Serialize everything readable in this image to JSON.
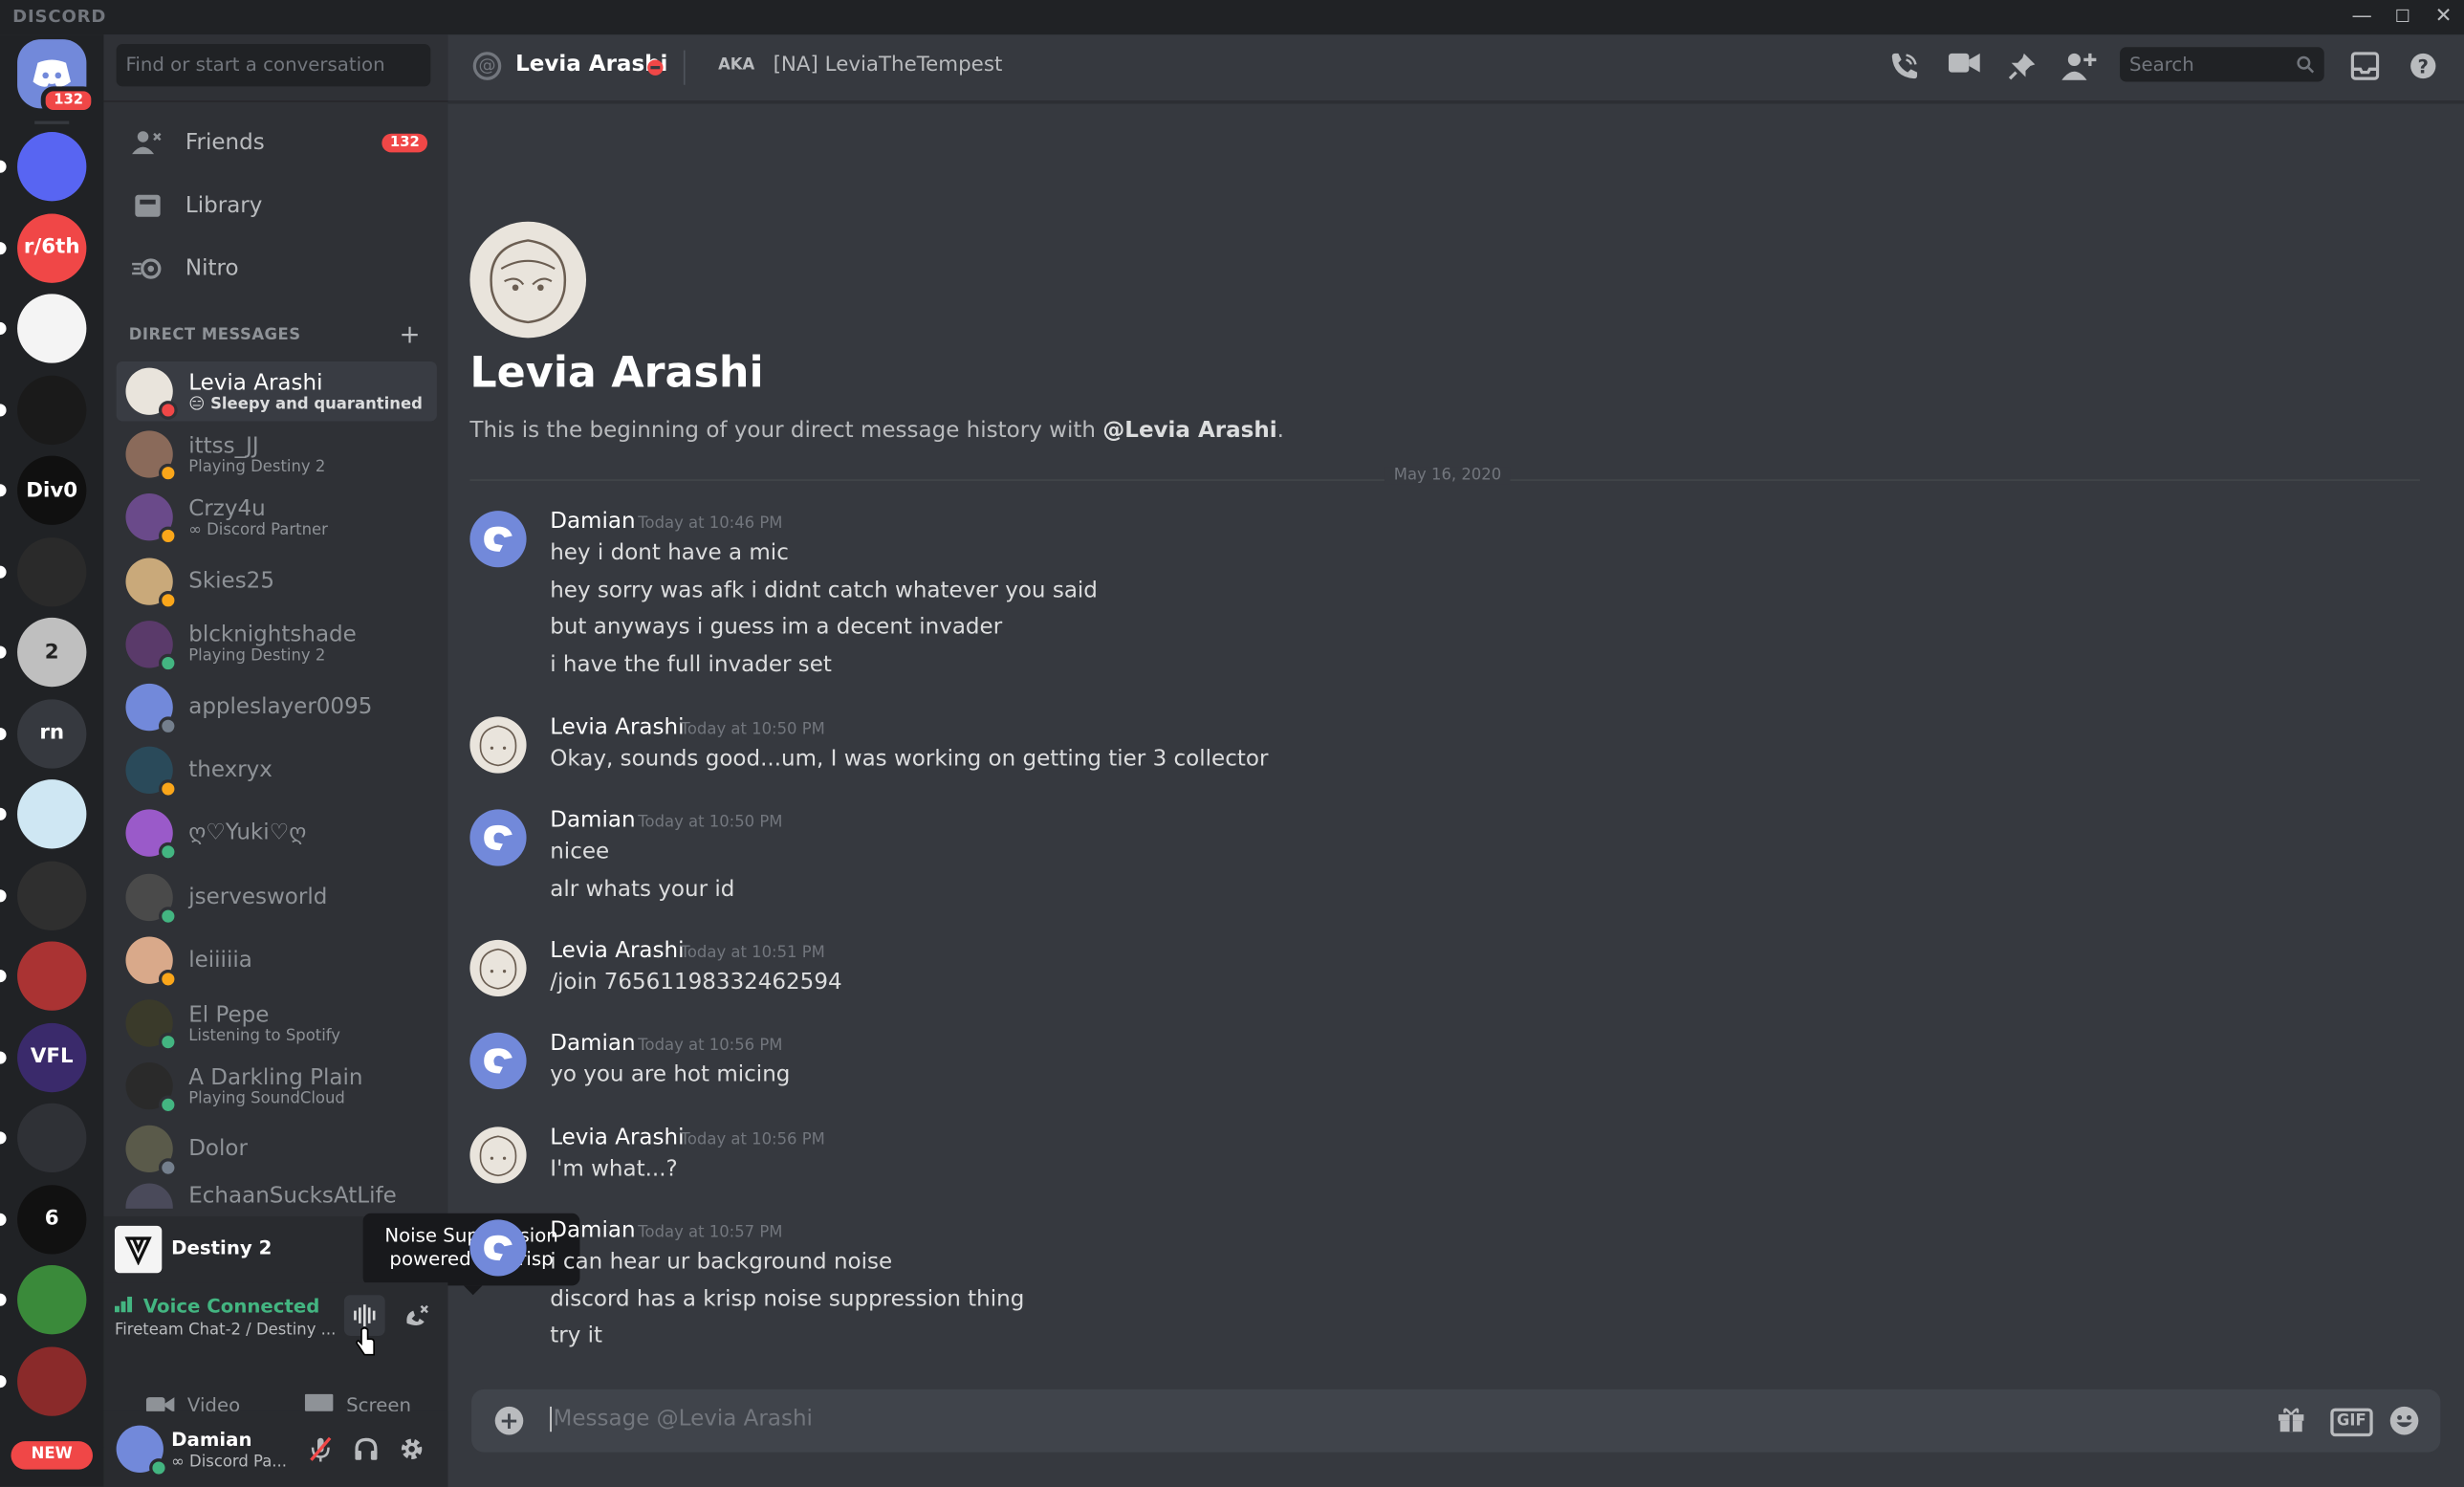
{
  "app": {
    "title": "DISCORD"
  },
  "window": {
    "minimize": "—",
    "maximize": "☐",
    "close": "✕"
  },
  "guilds": {
    "home_badge": "132",
    "items": [
      {
        "label": "",
        "color": "#5865f2"
      },
      {
        "label": "r/6th",
        "color": "#f04747"
      },
      {
        "label": "",
        "color": "#f4f4f4"
      },
      {
        "label": "",
        "color": "#1a1a1a"
      },
      {
        "label": "Div0",
        "color": "#101010"
      },
      {
        "label": "",
        "color": "#2a2a2a"
      },
      {
        "label": "2",
        "color": "#bfbfbf"
      },
      {
        "label": "rn",
        "color": "#36393f"
      },
      {
        "label": "",
        "color": "#cfe7f3"
      },
      {
        "label": "",
        "color": "#2f2f2f"
      },
      {
        "label": "",
        "color": "#a33"
      },
      {
        "label": "VFL",
        "color": "#3a2a6b"
      },
      {
        "label": "",
        "color": "#2f3136"
      },
      {
        "label": "6",
        "color": "#111111"
      },
      {
        "label": "",
        "color": "#3a8a3a"
      },
      {
        "label": "",
        "color": "#8a2a2a"
      }
    ],
    "new_label": "NEW"
  },
  "sidebar": {
    "search_placeholder": "Find or start a conversation",
    "nav": [
      {
        "label": "Friends",
        "badge": "132"
      },
      {
        "label": "Library"
      },
      {
        "label": "Nitro"
      }
    ],
    "dm_header": "DIRECT MESSAGES",
    "dms": [
      {
        "name": "Levia Arashi",
        "sub": "😑 Sleepy and quarantined",
        "status": "#f04747",
        "avatar": "#e9e4dc",
        "selected": true
      },
      {
        "name": "ittss_JJ",
        "sub": "Playing Destiny 2",
        "status": "#faa61a",
        "avatar": "#8a6a5a"
      },
      {
        "name": "Crzy4u",
        "sub": "∞ Discord Partner",
        "status": "#faa61a",
        "avatar": "#6a4a8a"
      },
      {
        "name": "Skies25",
        "sub": "",
        "status": "#faa61a",
        "avatar": "#c9a97a"
      },
      {
        "name": "blcknightshade",
        "sub": "Playing Destiny 2",
        "status": "#43b581",
        "avatar": "#5a3a6a"
      },
      {
        "name": "appleslayer0095",
        "sub": "",
        "status": "#747f8d",
        "avatar": "#7289da"
      },
      {
        "name": "thexryx",
        "sub": "",
        "status": "#faa61a",
        "avatar": "#2a4a5a"
      },
      {
        "name": "ღ♡Yuki♡ღ",
        "sub": "",
        "status": "#43b581",
        "avatar": "#9a5ac9"
      },
      {
        "name": "jservesworld",
        "sub": "",
        "status": "#43b581",
        "avatar": "#4a4a4a"
      },
      {
        "name": "leiiiiia",
        "sub": "",
        "status": "#faa61a",
        "avatar": "#d9a98a"
      },
      {
        "name": "El Pepe",
        "sub": "Listening to Spotify",
        "status": "#43b581",
        "avatar": "#3a3a2a"
      },
      {
        "name": "A Darkling Plain",
        "sub": "Playing SoundCloud",
        "status": "#43b581",
        "avatar": "#2a2a2a"
      },
      {
        "name": "Dolor",
        "sub": "",
        "status": "#747f8d",
        "avatar": "#5a5a4a"
      },
      {
        "name": "EchaanSucksAtLife",
        "sub": "",
        "status": "#747f8d",
        "avatar": "#4a4a5a"
      }
    ],
    "game": {
      "name": "Destiny 2"
    },
    "tooltip": {
      "line1": "Noise Suppression",
      "line2": "powered by Krisp"
    },
    "voice": {
      "status": "Voice Connected",
      "channel": "Fireteam Chat-2 / Destiny ...",
      "video_label": "Video",
      "screen_label": "Screen"
    },
    "user": {
      "name": "Damian",
      "sub": "∞ Discord Pa..."
    }
  },
  "chat": {
    "header": {
      "name": "Levia Arashi",
      "aka_label": "AKA",
      "aka": "[NA] LeviaTheTempest",
      "search_placeholder": "Search"
    },
    "intro": {
      "title": "Levia Arashi",
      "desc_prefix": "This is the beginning of your direct message history with ",
      "desc_mention": "@Levia Arashi",
      "desc_suffix": "."
    },
    "date_divider": "May 16, 2020",
    "messages": [
      {
        "author": "Damian",
        "time": "Today at 10:46 PM",
        "lines": [
          "hey i dont have a mic",
          "hey sorry was afk i didnt catch whatever you said",
          "but anyways i guess im a decent invader",
          "i have the full invader set"
        ]
      },
      {
        "author": "Levia Arashi",
        "time": "Today at 10:50 PM",
        "lines": [
          "Okay, sounds good...um, I was working on getting tier 3 collector"
        ]
      },
      {
        "author": "Damian",
        "time": "Today at 10:50 PM",
        "lines": [
          "nicee",
          "alr whats your id"
        ]
      },
      {
        "author": "Levia Arashi",
        "time": "Today at 10:51 PM",
        "lines": [
          "/join 76561198332462594"
        ]
      },
      {
        "author": "Damian",
        "time": "Today at 10:56 PM",
        "lines": [
          "yo you are hot micing"
        ]
      },
      {
        "author": "Levia Arashi",
        "time": "Today at 10:56 PM",
        "lines": [
          "I'm what...?"
        ]
      },
      {
        "author": "Damian",
        "time": "Today at 10:57 PM",
        "lines": [
          "i can hear ur background noise",
          "discord has a krisp noise suppression thing",
          "try it"
        ]
      }
    ],
    "composer": {
      "placeholder": "Message @Levia Arashi",
      "gif_label": "GIF"
    }
  }
}
